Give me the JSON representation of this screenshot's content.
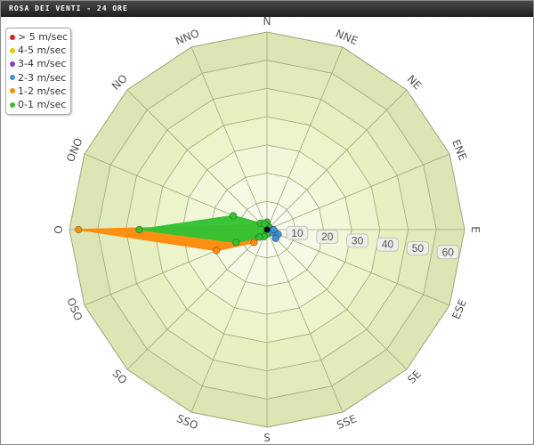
{
  "chart_title": "ROSA DEI VENTI - 24 ORE",
  "chart_data": {
    "type": "polar-area",
    "title": "ROSA DEI VENTI - 24 ORE",
    "directions": [
      "N",
      "NNE",
      "NE",
      "ENE",
      "E",
      "ESE",
      "SE",
      "SSE",
      "S",
      "SSO",
      "SO",
      "OSO",
      "O",
      "ONO",
      "NO",
      "NNO"
    ],
    "radial_ticks": [
      10,
      20,
      30,
      40,
      50,
      60
    ],
    "rmax": 65,
    "legend_position": "top-left",
    "series": [
      {
        "name": "> 5 m/sec",
        "color": "#e02020",
        "values": [
          0,
          0,
          0,
          0,
          0,
          0,
          0,
          0,
          0,
          0,
          0,
          0,
          0,
          0,
          0,
          0
        ]
      },
      {
        "name": "4-5 m/sec",
        "color": "#f2c400",
        "values": [
          0,
          0,
          0,
          0,
          0,
          0,
          0,
          0,
          0,
          0,
          0,
          0,
          0,
          0,
          0,
          0
        ]
      },
      {
        "name": "3-4 m/sec",
        "color": "#8a3ad0",
        "values": [
          0,
          0,
          0,
          0,
          0,
          0,
          0,
          0,
          0,
          0,
          0,
          0,
          0,
          0,
          0,
          0
        ]
      },
      {
        "name": "2-3 m/sec",
        "color": "#3d8fd8",
        "values": [
          0.5,
          0.5,
          0.5,
          0.5,
          2.2,
          4.0,
          4.0,
          0.5,
          0.5,
          0.5,
          0.5,
          0.5,
          0.5,
          0.5,
          0.5,
          0.5
        ]
      },
      {
        "name": "1-2 m/sec",
        "color": "#ff8c0a",
        "values": [
          2.0,
          1.0,
          1.0,
          1.0,
          1.5,
          3.5,
          4.0,
          0.6,
          1.0,
          2.0,
          6.0,
          18.0,
          62.0,
          4.0,
          1.0,
          2.0
        ]
      },
      {
        "name": "0-1 m/sec",
        "color": "#33c233",
        "values": [
          2.5,
          1.0,
          1.0,
          0.5,
          0.5,
          0.8,
          1.5,
          0.8,
          1.5,
          2.5,
          3.5,
          11.0,
          42.0,
          12.0,
          3.0,
          2.0
        ]
      }
    ]
  }
}
